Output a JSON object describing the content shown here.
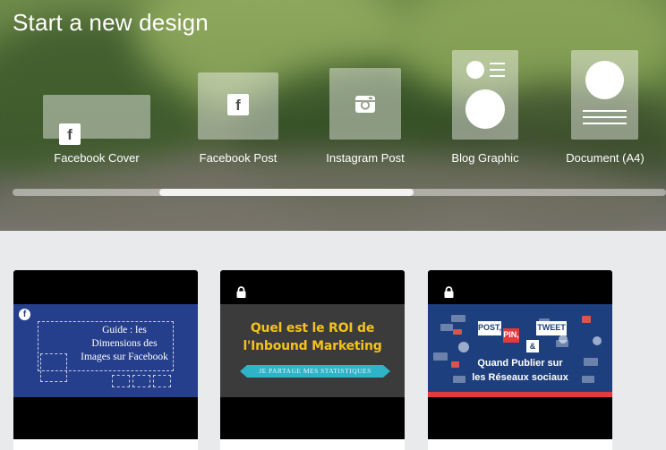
{
  "hero": {
    "title": "Start a new design",
    "design_types": [
      {
        "label": "Facebook Cover",
        "icon": "facebook-icon"
      },
      {
        "label": "Facebook Post",
        "icon": "facebook-icon"
      },
      {
        "label": "Instagram Post",
        "icon": "instagram-icon"
      },
      {
        "label": "Blog Graphic",
        "icon": "blog-graphic-icon"
      },
      {
        "label": "Document (A4)",
        "icon": "document-icon"
      }
    ]
  },
  "templates": [
    {
      "badge": "f",
      "lines": [
        "Guide : les",
        "Dimensions des",
        "Images sur Facebook"
      ]
    },
    {
      "locked": true,
      "title_lines": [
        "Quel est le ROI de",
        "l'Inbound Marketing"
      ],
      "ribbon": "JE PARTAGE MES STATISTIQUES"
    },
    {
      "locked": true,
      "chips": [
        "POST,",
        "PIN,",
        "TWEET",
        "&"
      ],
      "title_lines": [
        "Quand Publier sur",
        "les Réseaux sociaux"
      ]
    }
  ],
  "colors": {
    "facebook_blue": "#263f8c",
    "roi_yellow": "#f4c21a",
    "ribbon_teal": "#2fb3c6",
    "accent_red": "#e33b3b"
  }
}
